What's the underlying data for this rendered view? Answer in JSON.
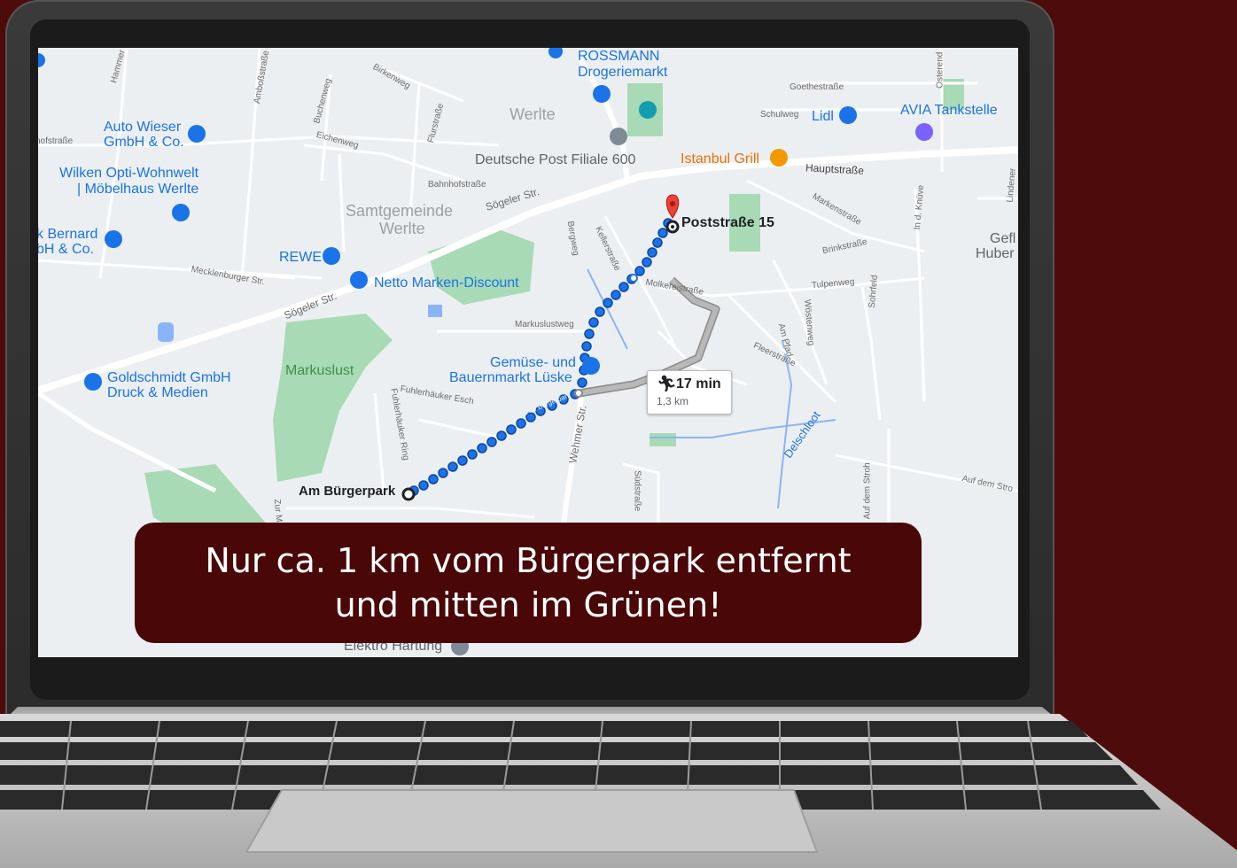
{
  "caption": {
    "line1": "Nur ca. 1 km vom Bürgerpark entfernt",
    "line2": "und mitten im Grünen!"
  },
  "route": {
    "start": "Am Bürgerpark",
    "end": "Poststraße 15",
    "duration": "17 min",
    "distance": "1,3 km"
  },
  "map": {
    "pois": {
      "rossmann": "ROSSMANN",
      "rossmann_sub": "Drogeriemarkt",
      "auto_wieser": "Auto Wieser",
      "auto_wieser_sub": "GmbH & Co.",
      "wilken": "Wilken Opti-Wohnwelt",
      "wilken_sub": "| Möbelhaus Werlte",
      "bernard": "k Bernard",
      "bernard_sub": "bH & Co.",
      "rewe": "REWE",
      "netto": "Netto Marken-Discount",
      "deutsche_post": "Deutsche Post Filiale 600",
      "istanbul_grill": "Istanbul Grill",
      "lidl": "Lidl",
      "avia": "AVIA Tankstelle",
      "goldschmidt": "Goldschmidt GmbH",
      "goldschmidt_sub": "Druck & Medien",
      "gemuese": "Gemüse- und",
      "gemuese_sub": "Bauernmarkt Lüske",
      "gefl": "Gefl",
      "gefl_sub": "Huber",
      "elektro": "Elektro Hartung",
      "markuslust": "Markuslust"
    },
    "towns": {
      "werlte": "Werlte",
      "samtgemeinde": "Samtgemeinde",
      "samtgemeinde_sub": "Werlte"
    },
    "streets": {
      "hauptstrasse": "Hauptstraße",
      "soegeler1": "Sögeler Str.",
      "soegeler2": "Sögeler Str.",
      "bahnhofstrasse": "Bahnhofstraße",
      "goethestrasse": "Goethestraße",
      "schulweg": "Schulweg",
      "markenstrasse": "Markenstraße",
      "brinkstrasse": "Brinkstraße",
      "tulpenweg": "Tulpenweg",
      "molkereistrasse": "Molkereistraße",
      "markuslustweg": "Markuslustweg",
      "fuhlerhaeuker_esch": "Fuhlerhäuker Esch",
      "fuhlerhaeuker_ring": "Fuhlerhäuker Ring",
      "wehmer": "Wehmer Str.",
      "suedstrasse": "Südstraße",
      "delschloot": "Delschloot",
      "auf_dem_stroh": "Auf dem Stro",
      "auf_dem_stroh2": "Auf dem Stroh",
      "fleerstrasse": "Fleerstraße",
      "am_pfad": "Am Pfad",
      "woestenweg": "Wöstenweg",
      "sohrfeld": "Sohrfeld",
      "mecklenburger": "Mecklenburger Str.",
      "birkenweg": "Birkenweg",
      "buchenweg": "Buchenweg",
      "eichenweg": "Eichenweg",
      "amboss": "Amboßstraße",
      "hammer": "Hammer",
      "hofstrasse": "hofstraße",
      "kellerstrasse": "Kellerstraße",
      "in_d_knuve": "In d. Knüve",
      "lindener": "Lindener",
      "osterend": "Osterend",
      "flurstrasse": "Flurstraße",
      "zur_ma": "Zur Ma",
      "bergweg": "Bergweg",
      "am_buergerpark_road": "Am Bürgerpark"
    }
  },
  "colors": {
    "background": "#4d0b0b",
    "caption_bg": "#4a0707",
    "route": "#1a73e8",
    "alt_route": "#9e9e9e",
    "pin": "#ea4335",
    "park": "#a8dab5"
  }
}
